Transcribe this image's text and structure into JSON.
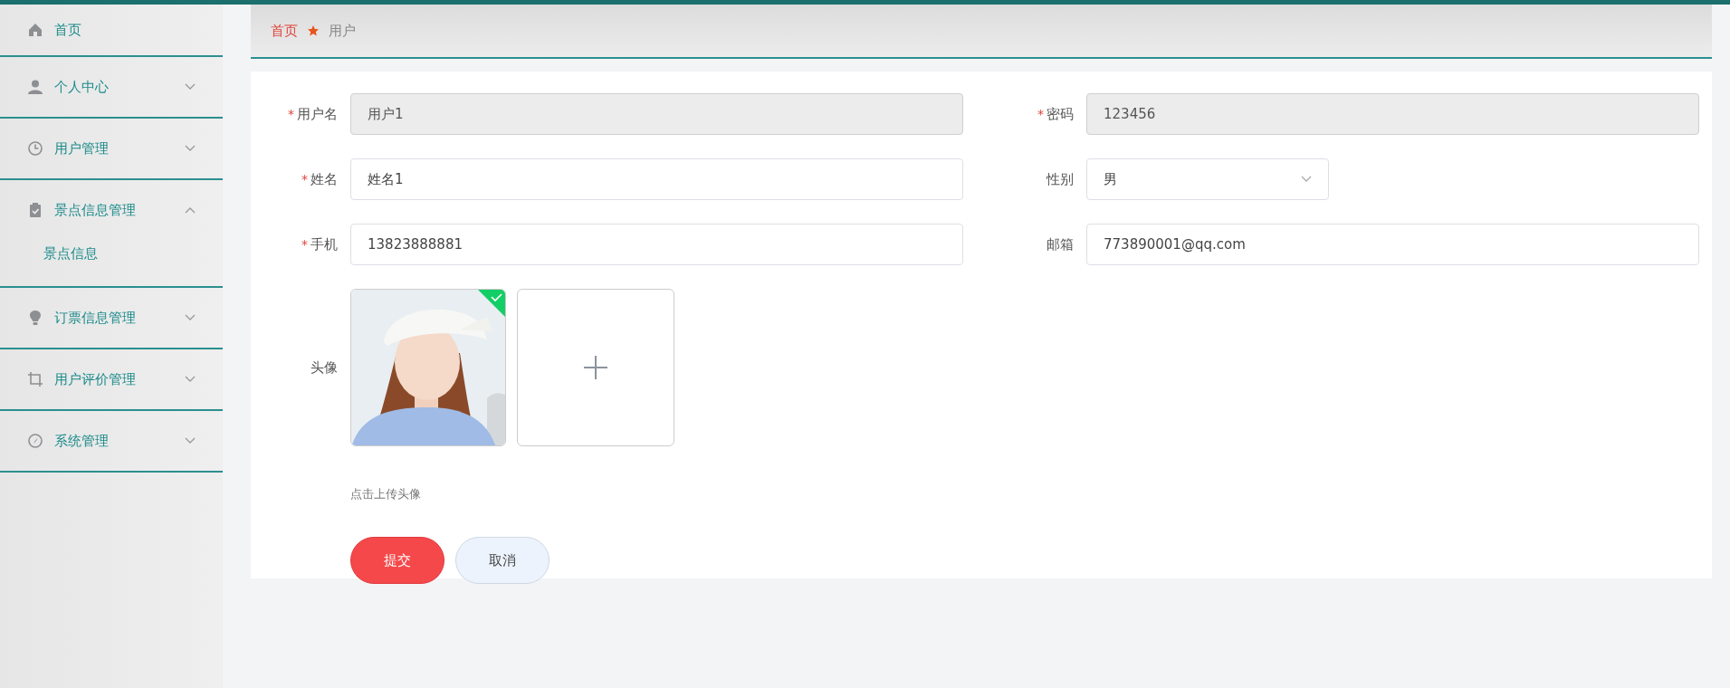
{
  "sidebar": {
    "items": [
      {
        "label": "首页",
        "kind": "link"
      },
      {
        "label": "个人中心",
        "kind": "menu",
        "expanded": false
      },
      {
        "label": "用户管理",
        "kind": "menu",
        "expanded": false
      },
      {
        "label": "景点信息管理",
        "kind": "menu",
        "expanded": true,
        "children": [
          {
            "label": "景点信息"
          }
        ]
      },
      {
        "label": "订票信息管理",
        "kind": "menu",
        "expanded": false
      },
      {
        "label": "用户评价管理",
        "kind": "menu",
        "expanded": false
      },
      {
        "label": "系统管理",
        "kind": "menu",
        "expanded": false
      }
    ]
  },
  "breadcrumb": [
    "首页",
    "用户"
  ],
  "form": {
    "fields": [
      {
        "label": "用户名",
        "required_mark": "*",
        "kind": "input",
        "value": "用户1",
        "disabled": true
      },
      {
        "label": "密码",
        "required_mark": "*",
        "kind": "input",
        "value": "123456",
        "disabled": true
      },
      {
        "label": "姓名",
        "required_mark": "*",
        "kind": "input",
        "value": "姓名1",
        "disabled": false
      },
      {
        "label": "性别",
        "kind": "select",
        "value": "男",
        "disabled": false
      },
      {
        "label": "手机",
        "required_mark": "*",
        "kind": "input",
        "value": "13823888881",
        "disabled": false
      },
      {
        "label": "邮箱",
        "kind": "input",
        "value": "773890001@qq.com",
        "disabled": false
      }
    ],
    "avatar": {
      "label": "头像",
      "uploaded": true,
      "hint": "点击上传头像"
    },
    "buttons": [
      {
        "label": "提交",
        "kind": "primary"
      },
      {
        "label": "取消",
        "kind": "secondary"
      }
    ]
  }
}
